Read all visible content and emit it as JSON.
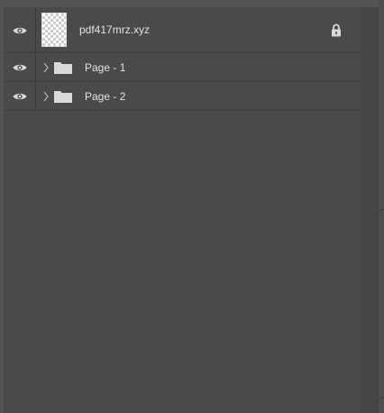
{
  "layers_panel": {
    "layers": [
      {
        "name": "pdf417mrz.xyz",
        "visibility_icon": "eye-icon",
        "thumbnail": "transparent-checkerboard",
        "locked": true,
        "lock_icon": "lock-icon"
      },
      {
        "name": "Page - 1",
        "visibility_icon": "eye-icon",
        "type": "group",
        "expanded": false,
        "expander_icon": "chevron-right-icon",
        "group_icon": "folder-icon"
      },
      {
        "name": "Page - 2",
        "visibility_icon": "eye-icon",
        "type": "group",
        "expanded": false,
        "expander_icon": "chevron-right-icon",
        "group_icon": "folder-icon"
      }
    ]
  },
  "colors": {
    "panel_background": "#4a4a4a",
    "outer_background": "#535353",
    "text": "#e2e2e2",
    "icon": "#d9d9d9",
    "divider": "#3c3c3c"
  }
}
